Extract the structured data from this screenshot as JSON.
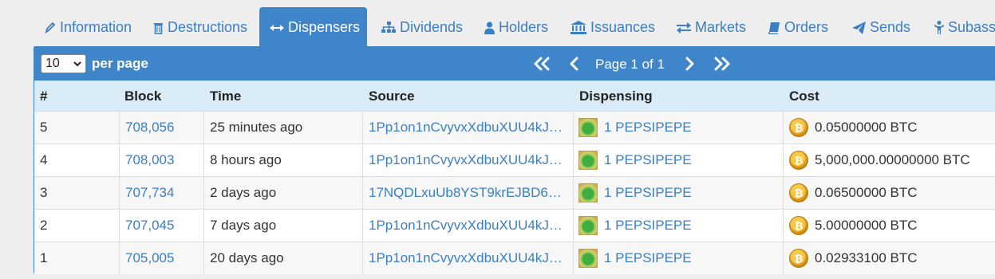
{
  "tabs": [
    {
      "label": "Information",
      "icon": "pencil-icon"
    },
    {
      "label": "Destructions",
      "icon": "trash-icon"
    },
    {
      "label": "Dispensers",
      "icon": "arrows-horizontal-icon",
      "active": true
    },
    {
      "label": "Dividends",
      "icon": "sitemap-icon"
    },
    {
      "label": "Holders",
      "icon": "user-icon"
    },
    {
      "label": "Issuances",
      "icon": "bank-icon"
    },
    {
      "label": "Markets",
      "icon": "exchange-icon"
    },
    {
      "label": "Orders",
      "icon": "book-icon"
    },
    {
      "label": "Sends",
      "icon": "paper-plane-icon"
    },
    {
      "label": "Subasse",
      "icon": "child-icon"
    }
  ],
  "toolbar": {
    "per_page_value": "10",
    "per_page_label": "per page",
    "page_text": "Page 1 of 1"
  },
  "table": {
    "headers": [
      "#",
      "Block",
      "Time",
      "Source",
      "Dispensing",
      "Cost"
    ],
    "rows": [
      {
        "num": "5",
        "block": "708,056",
        "time": "25 minutes ago",
        "source": "1Pp1on1nCvyvxXdbuXUU4kJ…",
        "dispensing": "1 PEPSIPEPE",
        "cost": "0.05000000 BTC"
      },
      {
        "num": "4",
        "block": "708,003",
        "time": "8 hours ago",
        "source": "1Pp1on1nCvyvxXdbuXUU4kJ…",
        "dispensing": "1 PEPSIPEPE",
        "cost": "5,000,000.00000000 BTC"
      },
      {
        "num": "3",
        "block": "707,734",
        "time": "2 days ago",
        "source": "17NQDLxuUb8YST9krEJBD6…",
        "dispensing": "1 PEPSIPEPE",
        "cost": "0.06500000 BTC"
      },
      {
        "num": "2",
        "block": "707,045",
        "time": "7 days ago",
        "source": "1Pp1on1nCvyvxXdbuXUU4kJ…",
        "dispensing": "1 PEPSIPEPE",
        "cost": "5.00000000 BTC"
      },
      {
        "num": "1",
        "block": "705,005",
        "time": "20 days ago",
        "source": "1Pp1on1nCvyvxXdbuXUU4kJ…",
        "dispensing": "1 PEPSIPEPE",
        "cost": "0.02933100 BTC"
      }
    ]
  },
  "colors": {
    "accent": "#3e86c9",
    "link": "#3a7fc3",
    "header_bg": "#d9ebf7"
  }
}
